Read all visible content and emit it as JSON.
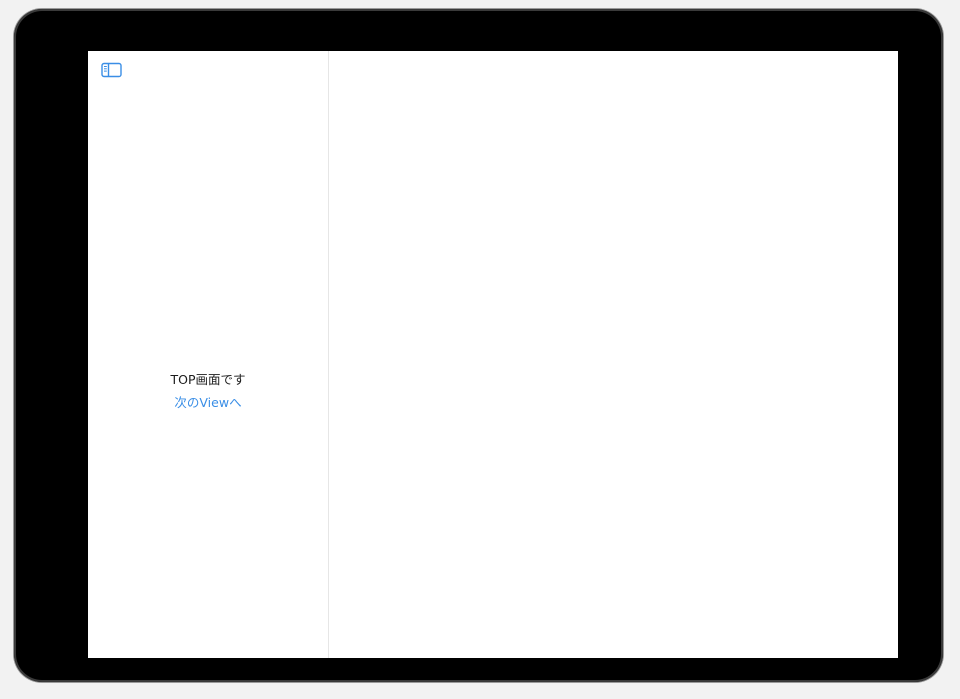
{
  "sidebar": {
    "toggle_icon": "sidebar-left-icon",
    "accent_color": "#3a8ee6"
  },
  "top_view": {
    "title": "TOP画面です",
    "next_link": "次のViewへ"
  }
}
